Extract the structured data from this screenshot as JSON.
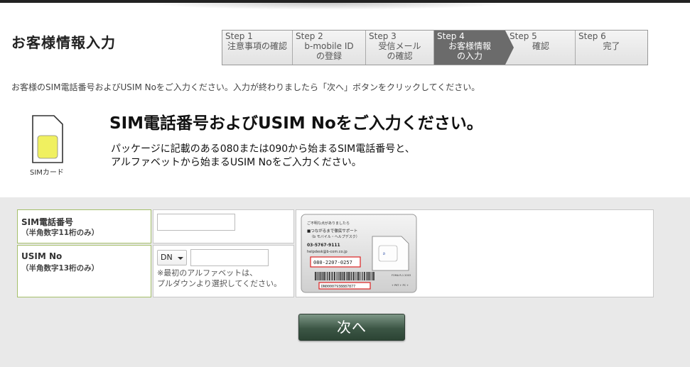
{
  "header": {
    "title": "お客様情報入力"
  },
  "steps": [
    {
      "num": "Step 1",
      "label": "注意事項の確認"
    },
    {
      "num": "Step 2",
      "label1": "b-mobile ID",
      "label2": "の登録"
    },
    {
      "num": "Step 3",
      "label1": "受信メール",
      "label2": "の確認"
    },
    {
      "num": "Step 4",
      "label1": "お客様情報",
      "label2": "の入力"
    },
    {
      "num": "Step 5",
      "label": "確認"
    },
    {
      "num": "Step 6",
      "label": "完了"
    }
  ],
  "intro_text": "お客様のSIM電話番号およびUSIM Noをご入力ください。入力が終わりましたら「次へ」ボタンをクリックしてください。",
  "sim_icon": {
    "label": "SIMカード",
    "chip_color": "#f0f060"
  },
  "main": {
    "heading": "SIM電話番号およびUSIM Noをご入力ください。",
    "desc_line1": "パッケージに記載のある080または090から始まるSIM電話番号と、",
    "desc_line2": "アルファベットから始まるUSIM Noをご入力ください。"
  },
  "form": {
    "phone": {
      "label": "SIM電話番号",
      "sublabel": "（半角数字11桁のみ）",
      "value": "",
      "placeholder": ""
    },
    "usim": {
      "label": "USIM No",
      "sublabel": "（半角数字13桁のみ）",
      "prefix_selected": "DN",
      "value": "",
      "note_line1": "※最初のアルファベットは、",
      "note_line2": "プルダウンより選択してください。"
    },
    "card_image": {
      "line1": "ご不明な点がありましたら",
      "line2": "■つながるまで徹底サポート",
      "line3": "（b モバイル・ヘルプデスク）",
      "phone": "03-5767-9111",
      "email": "helpdesk@b-com.co.jp",
      "sim_number": "080-2207-0257",
      "barcode_number": "DN00007938887877",
      "model": "FOMA R-1 2003",
      "footer": "+ PKT + PC +"
    },
    "next_label": "次へ"
  },
  "colors": {
    "accent_border": "#a5bf6a",
    "button": "#3c5645",
    "active_step": "#6b6b6b"
  }
}
